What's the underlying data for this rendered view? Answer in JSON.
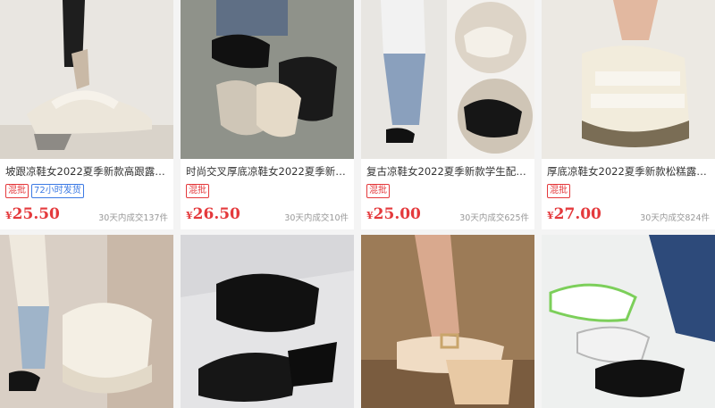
{
  "products_row1": [
    {
      "title": "坡跟凉鞋女2022夏季新款高跟露…",
      "tags": [
        "混批",
        "72小时发货"
      ],
      "currency": "¥",
      "price": "25.50",
      "sales": "30天内成交137件"
    },
    {
      "title": "时尚交叉厚底凉鞋女2022夏季新…",
      "tags": [
        "混批"
      ],
      "currency": "¥",
      "price": "26.50",
      "sales": "30天内成交10件"
    },
    {
      "title": "复古凉鞋女2022夏季新款学生配…",
      "tags": [
        "混批"
      ],
      "currency": "¥",
      "price": "25.00",
      "sales": "30天内成交625件"
    },
    {
      "title": "厚底凉鞋女2022夏季新款松糕露…",
      "tags": [
        "混批"
      ],
      "currency": "¥",
      "price": "27.00",
      "sales": "30天内成交824件"
    }
  ],
  "image_icons": [
    "wedge-sandal-photo",
    "cross-strap-sandal-photo",
    "retro-sandal-photo",
    "platform-sandal-photo",
    "velcro-platform-sandal-photo",
    "black-wedge-sandal-photo",
    "buckle-wedge-sandal-photo",
    "sporty-sandal-photo"
  ]
}
